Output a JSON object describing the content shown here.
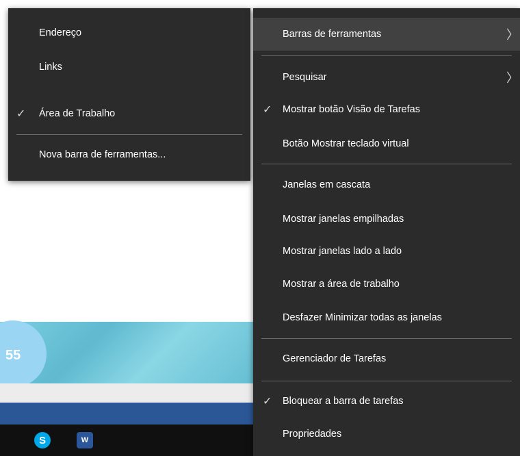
{
  "toolbar_submenu": {
    "items": [
      {
        "label": "Endereço",
        "checked": false
      },
      {
        "label": "Links",
        "checked": false
      },
      {
        "label": "Área de Trabalho",
        "checked": true
      },
      {
        "label": "Nova barra de ferramentas...",
        "checked": false
      }
    ]
  },
  "taskbar_menu": {
    "items": [
      {
        "label": "Barras de ferramentas",
        "submenu": true,
        "highlighted": true
      },
      {
        "label": "Pesquisar",
        "submenu": true
      },
      {
        "label": "Mostrar botão Visão de Tarefas",
        "checked": true
      },
      {
        "label": "Botão Mostrar teclado virtual"
      },
      {
        "label": "Janelas em cascata"
      },
      {
        "label": "Mostrar janelas empilhadas"
      },
      {
        "label": "Mostrar janelas lado a lado"
      },
      {
        "label": "Mostrar a área de trabalho"
      },
      {
        "label": "Desfazer Minimizar todas as janelas"
      },
      {
        "label": "Gerenciador de Tarefas"
      },
      {
        "label": "Bloquear a barra de tarefas",
        "checked": true
      },
      {
        "label": "Propriedades"
      }
    ]
  },
  "background": {
    "circle_text": "55",
    "skype_letter": "S",
    "word_letter": "W"
  },
  "glyphs": {
    "check": "✓",
    "arrow": "〉"
  },
  "colors": {
    "menu_bg": "#2b2b2b",
    "highlight": "#414141",
    "separator": "#6a6a6a",
    "text": "#ffffff"
  },
  "icons": [
    "skype-icon",
    "word-icon",
    "checkmark-icon",
    "chevron-right-icon"
  ]
}
